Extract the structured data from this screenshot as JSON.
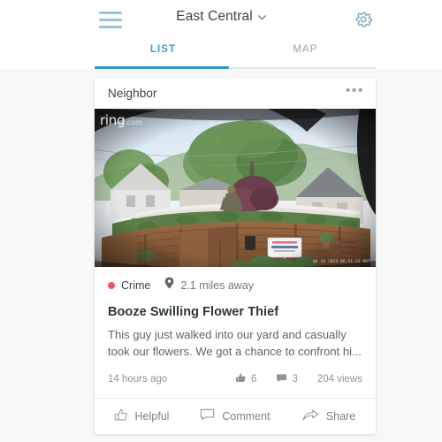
{
  "header": {
    "menu_icon": "hamburger-icon",
    "title": "East Central",
    "title_caret": "⌄",
    "settings_icon": "gear-icon"
  },
  "tabs": [
    {
      "id": "list",
      "label": "LIST",
      "active": true
    },
    {
      "id": "map",
      "label": "MAP",
      "active": false
    }
  ],
  "post": {
    "source": "Neighbor",
    "more_menu": "•••",
    "media": {
      "watermark": "ring",
      "watermark_suffix": ".com",
      "timestamp_overlay": "06 10 2019 06:51:22 MDT",
      "alt": "ring-doorbell-backyard-camera-still"
    },
    "category": "Crime",
    "category_color": "#ea5569",
    "location_icon": "map-pin-icon",
    "distance": "2.1 miles away",
    "title": "Booze Swilling Flower Thief",
    "body": "This guy just walked into our yard and casually took our flowers. We got a chance to confront hi...",
    "time_ago": "14 hours ago",
    "likes_icon": "thumbs-up-filled-icon",
    "likes": "6",
    "comments_icon": "comment-filled-icon",
    "comments": "3",
    "views": "204 views"
  },
  "actions": [
    {
      "id": "helpful",
      "label": "Helpful",
      "icon": "thumbs-up-outline-icon"
    },
    {
      "id": "comment",
      "label": "Comment",
      "icon": "comment-outline-icon"
    },
    {
      "id": "share",
      "label": "Share",
      "icon": "share-arrow-icon"
    }
  ],
  "theme": {
    "accent_blue": "#2e96c9",
    "menu_blue": "#96c3d6",
    "crime_red": "#ea5569",
    "page_bg": "#f7f8f8",
    "card_bg": "#ffffff",
    "text_dark": "#3b4448",
    "text_muted": "#8d9699"
  }
}
